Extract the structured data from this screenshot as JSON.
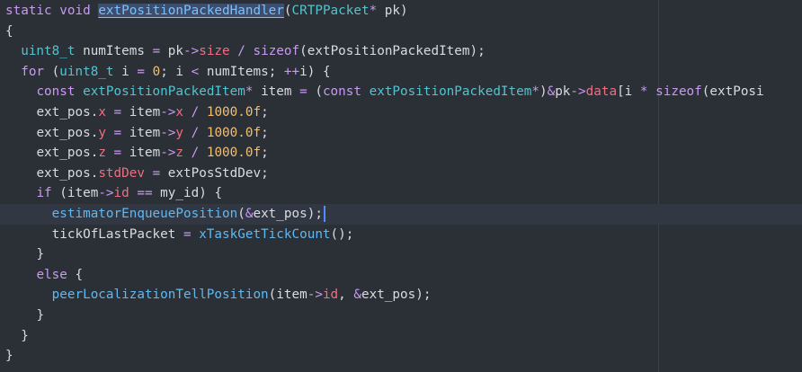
{
  "editor": {
    "ruler_column_visible": true,
    "lines": [
      {
        "indent": "",
        "tokens": [
          {
            "t": "kw",
            "v": "static"
          },
          {
            "t": "plain",
            "v": " "
          },
          {
            "t": "kw",
            "v": "void"
          },
          {
            "t": "plain",
            "v": " "
          },
          {
            "t": "fn-decl",
            "v": "extPositionPackedHandler"
          },
          {
            "t": "plain",
            "v": "("
          },
          {
            "t": "type",
            "v": "CRTPPacket"
          },
          {
            "t": "op",
            "v": "*"
          },
          {
            "t": "plain",
            "v": " pk)"
          }
        ]
      },
      {
        "indent": "",
        "tokens": [
          {
            "t": "plain",
            "v": "{"
          }
        ]
      },
      {
        "indent": "  ",
        "tokens": [
          {
            "t": "type",
            "v": "uint8_t"
          },
          {
            "t": "plain",
            "v": " numItems "
          },
          {
            "t": "op",
            "v": "="
          },
          {
            "t": "plain",
            "v": " pk"
          },
          {
            "t": "op",
            "v": "->"
          },
          {
            "t": "member",
            "v": "size"
          },
          {
            "t": "plain",
            "v": " "
          },
          {
            "t": "op",
            "v": "/"
          },
          {
            "t": "plain",
            "v": " "
          },
          {
            "t": "kw",
            "v": "sizeof"
          },
          {
            "t": "plain",
            "v": "(extPositionPackedItem);"
          }
        ]
      },
      {
        "indent": "  ",
        "tokens": [
          {
            "t": "kw",
            "v": "for"
          },
          {
            "t": "plain",
            "v": " ("
          },
          {
            "t": "type",
            "v": "uint8_t"
          },
          {
            "t": "plain",
            "v": " i "
          },
          {
            "t": "op",
            "v": "="
          },
          {
            "t": "plain",
            "v": " "
          },
          {
            "t": "num",
            "v": "0"
          },
          {
            "t": "plain",
            "v": "; i "
          },
          {
            "t": "op",
            "v": "<"
          },
          {
            "t": "plain",
            "v": " numItems; "
          },
          {
            "t": "op",
            "v": "++"
          },
          {
            "t": "plain",
            "v": "i) {"
          }
        ]
      },
      {
        "indent": "    ",
        "tokens": [
          {
            "t": "kw",
            "v": "const"
          },
          {
            "t": "plain",
            "v": " "
          },
          {
            "t": "type",
            "v": "extPositionPackedItem"
          },
          {
            "t": "op",
            "v": "*"
          },
          {
            "t": "plain",
            "v": " item "
          },
          {
            "t": "op",
            "v": "="
          },
          {
            "t": "plain",
            "v": " ("
          },
          {
            "t": "kw",
            "v": "const"
          },
          {
            "t": "plain",
            "v": " "
          },
          {
            "t": "type",
            "v": "extPositionPackedItem"
          },
          {
            "t": "op",
            "v": "*"
          },
          {
            "t": "plain",
            "v": ")"
          },
          {
            "t": "op",
            "v": "&"
          },
          {
            "t": "plain",
            "v": "pk"
          },
          {
            "t": "op",
            "v": "->"
          },
          {
            "t": "member",
            "v": "data"
          },
          {
            "t": "plain",
            "v": "[i "
          },
          {
            "t": "op",
            "v": "*"
          },
          {
            "t": "plain",
            "v": " "
          },
          {
            "t": "kw",
            "v": "sizeof"
          },
          {
            "t": "plain",
            "v": "(extPosi"
          }
        ]
      },
      {
        "indent": "    ",
        "tokens": [
          {
            "t": "plain",
            "v": "ext_pos."
          },
          {
            "t": "member",
            "v": "x"
          },
          {
            "t": "plain",
            "v": " "
          },
          {
            "t": "op",
            "v": "="
          },
          {
            "t": "plain",
            "v": " item"
          },
          {
            "t": "op",
            "v": "->"
          },
          {
            "t": "member",
            "v": "x"
          },
          {
            "t": "plain",
            "v": " "
          },
          {
            "t": "op",
            "v": "/"
          },
          {
            "t": "plain",
            "v": " "
          },
          {
            "t": "num",
            "v": "1000.0f"
          },
          {
            "t": "plain",
            "v": ";"
          }
        ]
      },
      {
        "indent": "    ",
        "tokens": [
          {
            "t": "plain",
            "v": "ext_pos."
          },
          {
            "t": "member",
            "v": "y"
          },
          {
            "t": "plain",
            "v": " "
          },
          {
            "t": "op",
            "v": "="
          },
          {
            "t": "plain",
            "v": " item"
          },
          {
            "t": "op",
            "v": "->"
          },
          {
            "t": "member",
            "v": "y"
          },
          {
            "t": "plain",
            "v": " "
          },
          {
            "t": "op",
            "v": "/"
          },
          {
            "t": "plain",
            "v": " "
          },
          {
            "t": "num",
            "v": "1000.0f"
          },
          {
            "t": "plain",
            "v": ";"
          }
        ]
      },
      {
        "indent": "    ",
        "tokens": [
          {
            "t": "plain",
            "v": "ext_pos."
          },
          {
            "t": "member",
            "v": "z"
          },
          {
            "t": "plain",
            "v": " "
          },
          {
            "t": "op",
            "v": "="
          },
          {
            "t": "plain",
            "v": " item"
          },
          {
            "t": "op",
            "v": "->"
          },
          {
            "t": "member",
            "v": "z"
          },
          {
            "t": "plain",
            "v": " "
          },
          {
            "t": "op",
            "v": "/"
          },
          {
            "t": "plain",
            "v": " "
          },
          {
            "t": "num",
            "v": "1000.0f"
          },
          {
            "t": "plain",
            "v": ";"
          }
        ]
      },
      {
        "indent": "    ",
        "tokens": [
          {
            "t": "plain",
            "v": "ext_pos."
          },
          {
            "t": "member",
            "v": "stdDev"
          },
          {
            "t": "plain",
            "v": " "
          },
          {
            "t": "op",
            "v": "="
          },
          {
            "t": "plain",
            "v": " extPosStdDev;"
          }
        ]
      },
      {
        "indent": "    ",
        "tokens": [
          {
            "t": "kw",
            "v": "if"
          },
          {
            "t": "plain",
            "v": " (item"
          },
          {
            "t": "op",
            "v": "->"
          },
          {
            "t": "member",
            "v": "id"
          },
          {
            "t": "plain",
            "v": " "
          },
          {
            "t": "op",
            "v": "=="
          },
          {
            "t": "plain",
            "v": " my_id) {"
          }
        ]
      },
      {
        "indent": "      ",
        "current": true,
        "caret": true,
        "tokens": [
          {
            "t": "fn",
            "v": "estimatorEnqueuePosition"
          },
          {
            "t": "plain",
            "v": "("
          },
          {
            "t": "op",
            "v": "&"
          },
          {
            "t": "plain",
            "v": "ext_pos);"
          }
        ]
      },
      {
        "indent": "      ",
        "tokens": [
          {
            "t": "plain",
            "v": "tickOfLastPacket "
          },
          {
            "t": "op",
            "v": "="
          },
          {
            "t": "plain",
            "v": " "
          },
          {
            "t": "fn",
            "v": "xTaskGetTickCount"
          },
          {
            "t": "plain",
            "v": "();"
          }
        ]
      },
      {
        "indent": "    ",
        "tokens": [
          {
            "t": "plain",
            "v": "}"
          }
        ]
      },
      {
        "indent": "    ",
        "tokens": [
          {
            "t": "kw",
            "v": "else"
          },
          {
            "t": "plain",
            "v": " {"
          }
        ]
      },
      {
        "indent": "      ",
        "tokens": [
          {
            "t": "fn",
            "v": "peerLocalizationTellPosition"
          },
          {
            "t": "plain",
            "v": "(item"
          },
          {
            "t": "op",
            "v": "->"
          },
          {
            "t": "member",
            "v": "id"
          },
          {
            "t": "plain",
            "v": ", "
          },
          {
            "t": "op",
            "v": "&"
          },
          {
            "t": "plain",
            "v": "ext_pos);"
          }
        ]
      },
      {
        "indent": "    ",
        "tokens": [
          {
            "t": "plain",
            "v": "}"
          }
        ]
      },
      {
        "indent": "  ",
        "tokens": [
          {
            "t": "plain",
            "v": "}"
          }
        ]
      },
      {
        "indent": "",
        "tokens": [
          {
            "t": "plain",
            "v": "}"
          }
        ]
      }
    ]
  },
  "colors": {
    "background": "#2b2f36",
    "current_line": "#323843",
    "keyword": "#c99af2",
    "type": "#52c4cf",
    "function": "#61b8f0",
    "number": "#f2c073",
    "member": "#ef6f82",
    "text": "#d8dbe0",
    "caret": "#528bff"
  }
}
